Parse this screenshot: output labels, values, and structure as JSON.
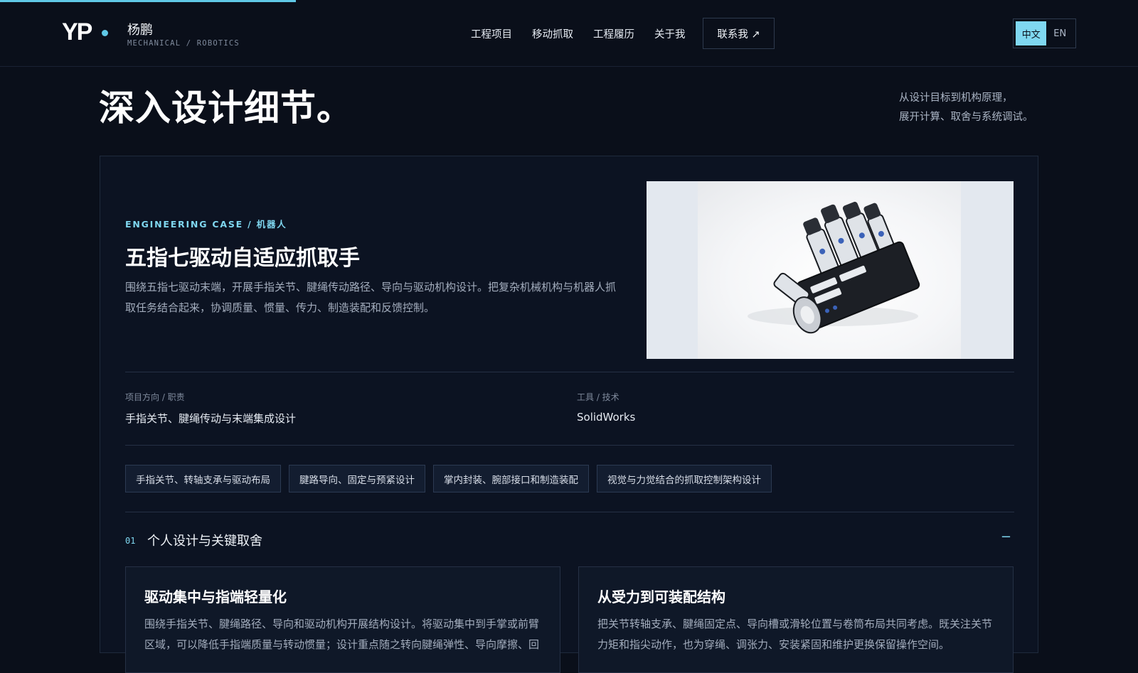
{
  "progress": {
    "fraction": 0.26,
    "color": "#5fc8e6"
  },
  "brand": {
    "logo": "YP",
    "name": "杨鹏",
    "subtitle": "MECHANICAL / ROBOTICS"
  },
  "nav": {
    "items": [
      "工程项目",
      "移动抓取",
      "工程履历",
      "关于我"
    ],
    "contact": "联系我 ↗"
  },
  "lang": {
    "zh": "中文",
    "en": "EN",
    "active": "中文"
  },
  "hero": {
    "title": "深入设计细节。",
    "note_line1": "从设计目标到机构原理，",
    "note_line2": "展开计算、取舍与系统调试。"
  },
  "case": {
    "tag": "ENGINEERING CASE / 机器人",
    "title": "五指七驱动自适应抓取手",
    "description": "围绕五指七驱动末端，开展手指关节、腱绳传动路径、导向与驱动机构设计。把复杂机械机构与机器人抓取任务结合起来，协调质量、惯量、传力、制造装配和反馈控制。",
    "image_icon": "robotic-hand-render",
    "meta": {
      "role_label": "项目方向 / 职责",
      "role_value": "手指关节、腱绳传动与末端集成设计",
      "tools_label": "工具 / 技术",
      "tools_value": "SolidWorks"
    },
    "chips": [
      "手指关节、转轴支承与驱动布局",
      "腱路导向、固定与预紧设计",
      "掌内封装、腕部接口和制造装配",
      "视觉与力觉结合的抓取控制架构设计"
    ],
    "section": {
      "number": "01",
      "title": "个人设计与关键取舍",
      "toggle": "−"
    },
    "cards": [
      {
        "title": "驱动集中与指端轻量化",
        "text": "围绕手指关节、腱绳路径、导向和驱动机构开展结构设计。将驱动集中到手掌或前臂区域，可以降低手指端质量与转动惯量；设计重点随之转向腱绳弹性、导向摩擦、回"
      },
      {
        "title": "从受力到可装配结构",
        "text": "把关节转轴支承、腱绳固定点、导向槽或滑轮位置与卷筒布局共同考虑。既关注关节力矩和指尖动作，也为穿绳、调张力、安装紧固和维护更换保留操作空间。"
      }
    ]
  }
}
